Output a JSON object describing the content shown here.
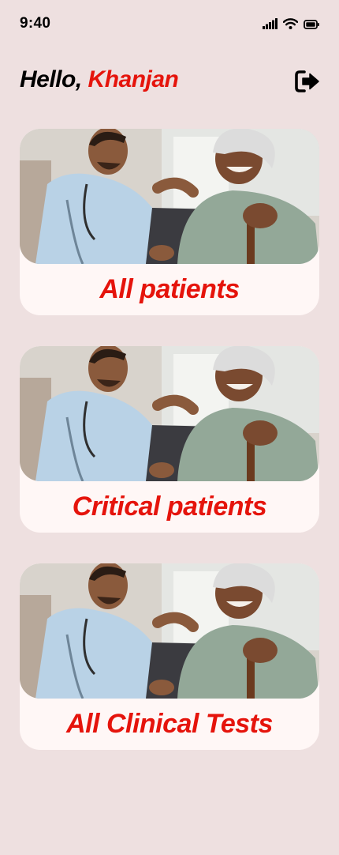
{
  "status_bar": {
    "time": "9:40",
    "icons": [
      "cellular-signal-icon",
      "wifi-icon",
      "battery-icon"
    ]
  },
  "header": {
    "greeting": "Hello,",
    "user_name": "Khanjan",
    "logout_icon": "logout-icon"
  },
  "cards": [
    {
      "label": "All patients",
      "image": "doctor-with-elderly-patient-photo"
    },
    {
      "label": "Critical patients",
      "image": "doctor-with-elderly-patient-photo"
    },
    {
      "label": "All Clinical Tests",
      "image": "doctor-with-elderly-patient-photo"
    }
  ],
  "colors": {
    "background": "#eee0e0",
    "card": "#fff7f6",
    "accent": "#e5140c",
    "text": "#000000"
  }
}
